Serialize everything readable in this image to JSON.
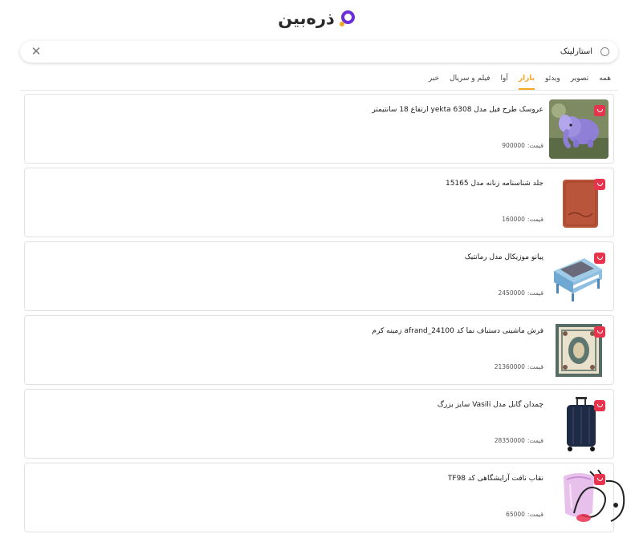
{
  "header": {
    "logo_text": "ذره‌بین"
  },
  "search": {
    "query": "استارلینک",
    "placeholder": ""
  },
  "tabs": [
    {
      "label": "همه",
      "active": false
    },
    {
      "label": "تصویر",
      "active": false
    },
    {
      "label": "ویدئو",
      "active": false
    },
    {
      "label": "بازار",
      "active": true
    },
    {
      "label": "آوا",
      "active": false
    },
    {
      "label": "فیلم و سریال",
      "active": false
    },
    {
      "label": "خبر",
      "active": false
    }
  ],
  "results": [
    {
      "title": "عروسک طرح فیل مدل yekta 6308 ارتفاع 18 سانتیمتر",
      "price_label": "قیمت:",
      "price": "900000",
      "image": "elephant-plush"
    },
    {
      "title": "جلد شناسنامه زنانه مدل 15165",
      "price_label": "قیمت:",
      "price": "160000",
      "image": "leather-cover"
    },
    {
      "title": "پیانو موزیکال مدل رمانتیک",
      "price_label": "قیمت:",
      "price": "2450000",
      "image": "toy-piano"
    },
    {
      "title": "فرش ماشینی دستباف نما کد afrand_24100 زمینه کرم",
      "price_label": "قیمت:",
      "price": "21360000",
      "image": "carpet"
    },
    {
      "title": "چمدان گابل مدل Vasili سایز بزرگ",
      "price_label": "قیمت:",
      "price": "28350000",
      "image": "suitcase"
    },
    {
      "title": "نقاب نافت آرایشگاهی کد TF98",
      "price_label": "قیمت:",
      "price": "65000",
      "image": "face-shield"
    }
  ],
  "colors": {
    "brand_purple": "#6a2fd8",
    "brand_orange": "#f5a623",
    "badge_red": "#e8334d",
    "active_tab": "#f5a623"
  }
}
